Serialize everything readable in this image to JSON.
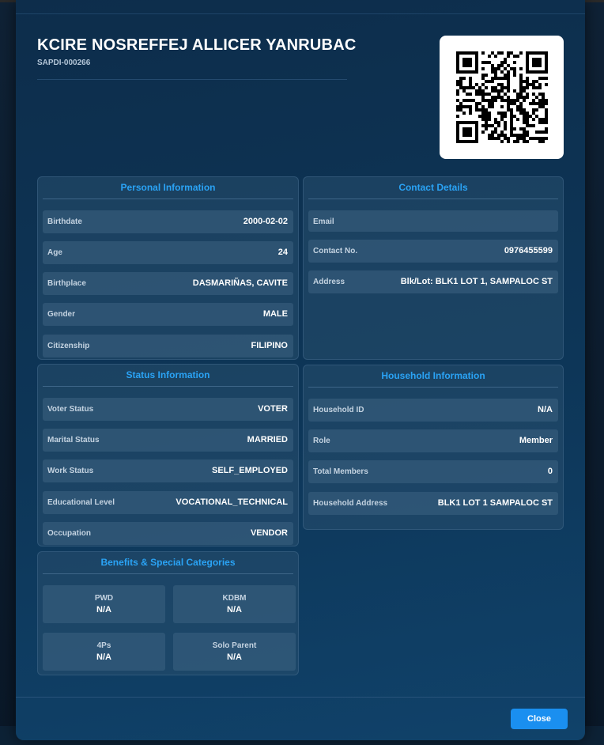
{
  "resident": {
    "name": "KCIRE NOSREFFEJ ALLICER YANRUBAC",
    "id": "SAPDI-000266"
  },
  "personal": {
    "title": "Personal Information",
    "rows": [
      {
        "label": "Birthdate",
        "value": "2000-02-02"
      },
      {
        "label": "Age",
        "value": "24"
      },
      {
        "label": "Birthplace",
        "value": "DASMARIÑAS, CAVITE"
      },
      {
        "label": "Gender",
        "value": "MALE"
      },
      {
        "label": "Citizenship",
        "value": "FILIPINO"
      }
    ]
  },
  "contact": {
    "title": "Contact Details",
    "rows": [
      {
        "label": "Email",
        "value": ""
      },
      {
        "label": "Contact No.",
        "value": "0976455599"
      },
      {
        "label": "Address",
        "value": "Blk/Lot: BLK1 LOT 1, SAMPALOC ST"
      }
    ]
  },
  "status": {
    "title": "Status Information",
    "rows": [
      {
        "label": "Voter Status",
        "value": "VOTER"
      },
      {
        "label": "Marital Status",
        "value": "MARRIED"
      },
      {
        "label": "Work Status",
        "value": "SELF_EMPLOYED"
      },
      {
        "label": "Educational Level",
        "value": "VOCATIONAL_TECHNICAL"
      },
      {
        "label": "Occupation",
        "value": "VENDOR"
      }
    ]
  },
  "household": {
    "title": "Household Information",
    "rows": [
      {
        "label": "Household ID",
        "value": "N/A"
      },
      {
        "label": "Role",
        "value": "Member"
      },
      {
        "label": "Total Members",
        "value": "0"
      },
      {
        "label": "Household Address",
        "value": "BLK1 LOT 1 SAMPALOC ST"
      }
    ]
  },
  "benefits": {
    "title": "Benefits & Special Categories",
    "items": [
      {
        "label": "PWD",
        "value": "N/A"
      },
      {
        "label": "KDBM",
        "value": "N/A"
      },
      {
        "label": "4Ps",
        "value": "N/A"
      },
      {
        "label": "Solo Parent",
        "value": "N/A"
      }
    ]
  },
  "footer": {
    "close_label": "Close"
  },
  "icons": {
    "qr": "qr-code-icon"
  },
  "colors": {
    "accent": "#2aa3f5",
    "button": "#1a8ff0",
    "modal_bg": "#0d3658"
  }
}
